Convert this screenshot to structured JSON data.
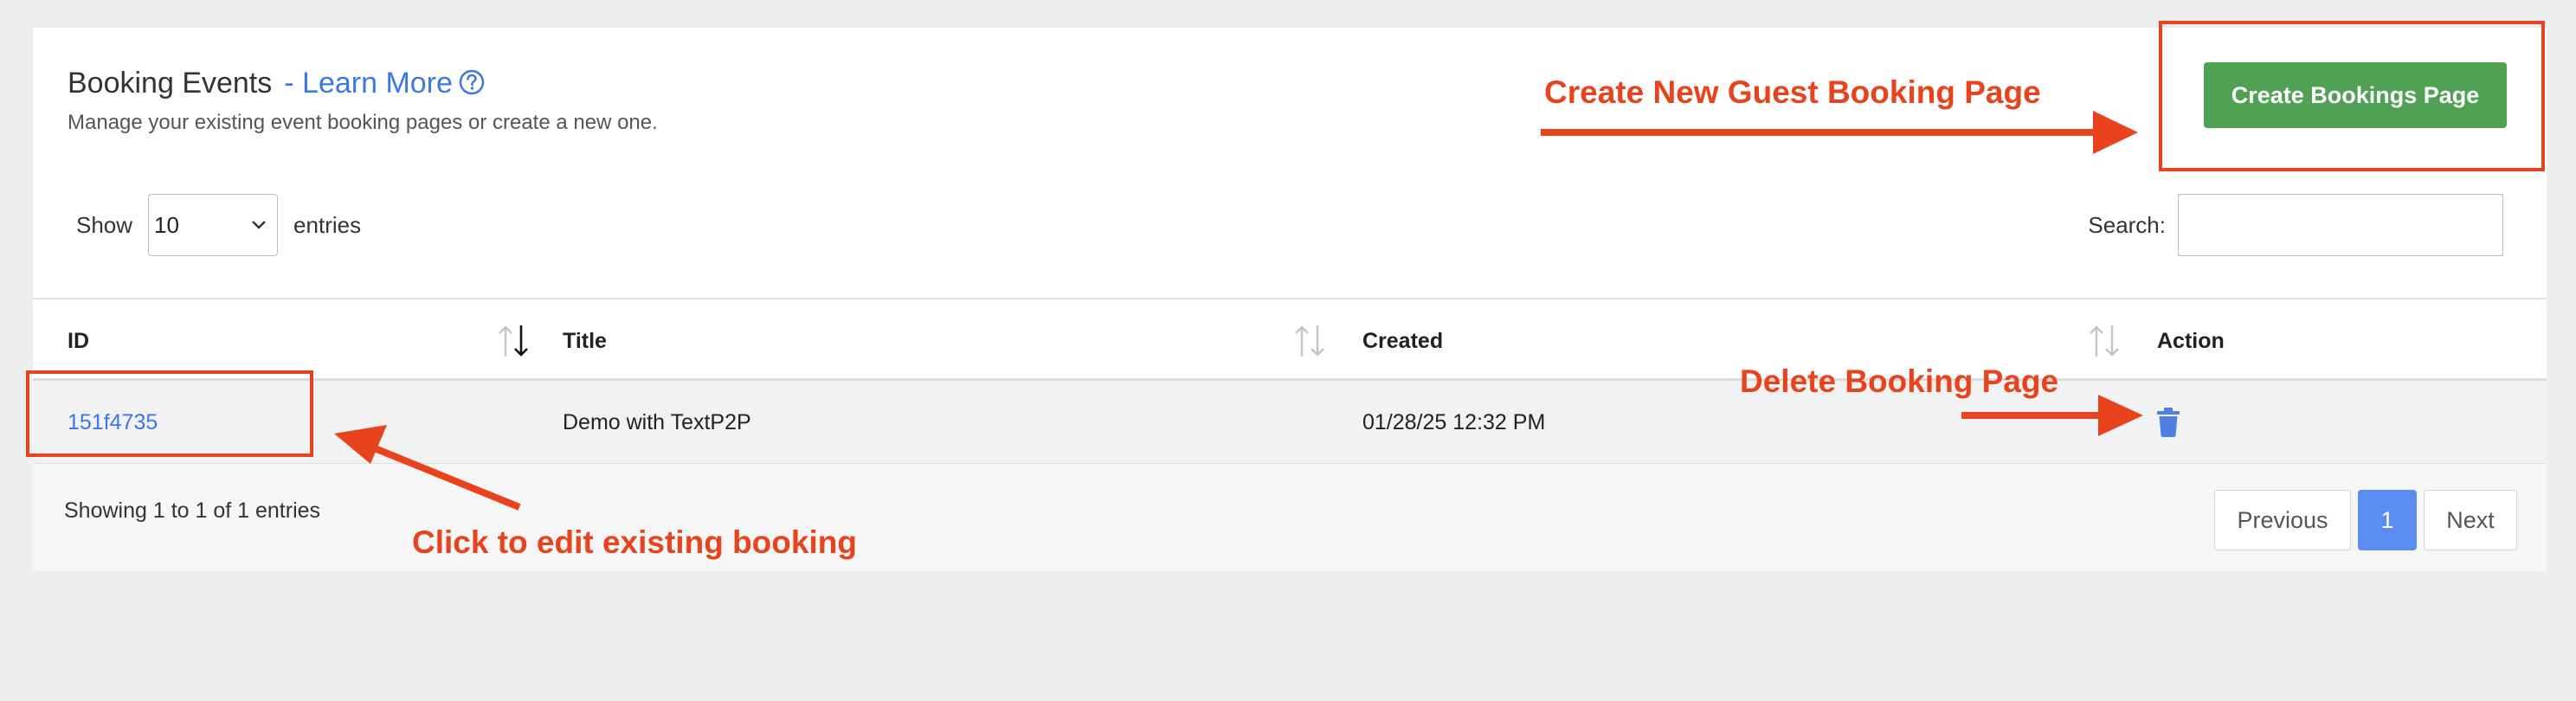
{
  "header": {
    "title": "Booking Events",
    "learn_more": "- Learn More",
    "subtitle": "Manage your existing event booking pages or create a new one.",
    "create_button": "Create Bookings Page"
  },
  "controls": {
    "show_label": "Show",
    "entries_value": "10",
    "entries_label": "entries",
    "search_label": "Search:"
  },
  "table": {
    "columns": [
      "ID",
      "Title",
      "Created",
      "Action"
    ],
    "rows": [
      {
        "id": "151f4735",
        "title": "Demo with TextP2P",
        "created": "01/28/25 12:32 PM"
      }
    ]
  },
  "footer": {
    "info": "Showing 1 to 1 of 1 entries",
    "previous": "Previous",
    "page": "1",
    "next": "Next"
  },
  "annotations": {
    "create_new": "Create New Guest Booking Page",
    "delete": "Delete Booking Page",
    "edit": "Click to edit existing booking"
  },
  "colors": {
    "accent_blue": "#3d77e6",
    "create_green": "#4fa153",
    "annotation_red": "#e8431c",
    "current_page": "#5b8def"
  }
}
